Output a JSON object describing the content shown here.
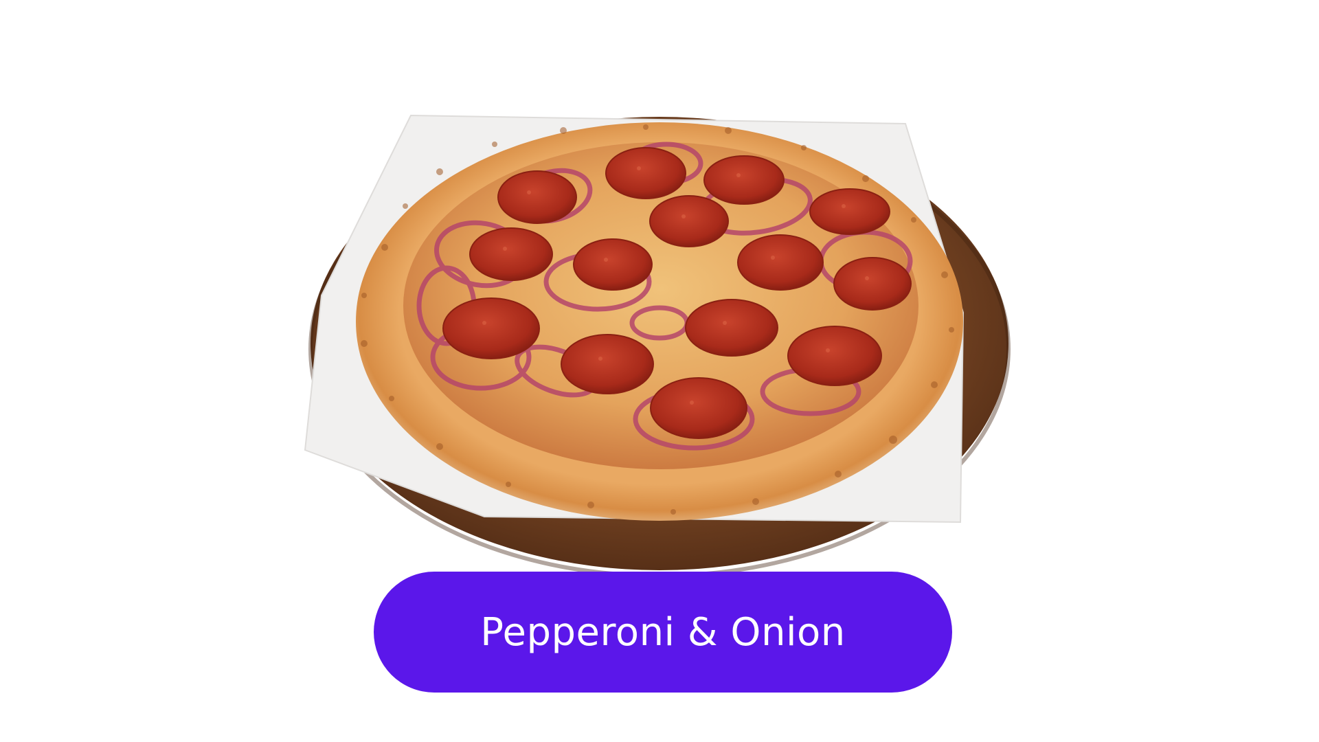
{
  "product": {
    "name": "Pepperoni & Onion",
    "image_icon": "pizza-image"
  },
  "colors": {
    "button_bg": "#5b17ea",
    "button_text": "#ffffff",
    "background": "#ffffff",
    "board": "#6b3f22",
    "paper": "#efefef",
    "crust": "#d9934f",
    "cheese": "#e8b060",
    "pepperoni": "#b3321f",
    "onion": "#b34567"
  }
}
